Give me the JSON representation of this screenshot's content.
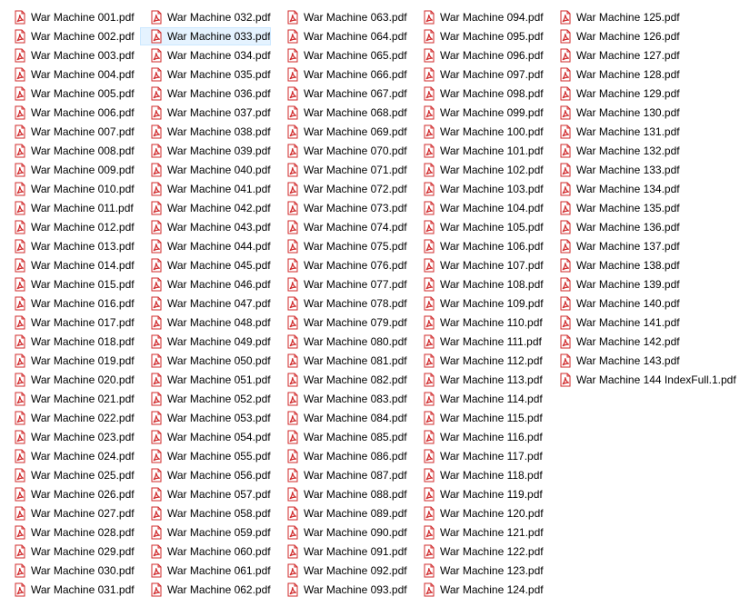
{
  "file_list": {
    "icon": "pdf-file-icon",
    "icon_color": "#d0282a",
    "hover_index": 32,
    "files": [
      "War Machine 001.pdf",
      "War Machine 002.pdf",
      "War Machine 003.pdf",
      "War Machine 004.pdf",
      "War Machine 005.pdf",
      "War Machine 006.pdf",
      "War Machine 007.pdf",
      "War Machine 008.pdf",
      "War Machine 009.pdf",
      "War Machine 010.pdf",
      "War Machine 011.pdf",
      "War Machine 012.pdf",
      "War Machine 013.pdf",
      "War Machine 014.pdf",
      "War Machine 015.pdf",
      "War Machine 016.pdf",
      "War Machine 017.pdf",
      "War Machine 018.pdf",
      "War Machine 019.pdf",
      "War Machine 020.pdf",
      "War Machine 021.pdf",
      "War Machine 022.pdf",
      "War Machine 023.pdf",
      "War Machine 024.pdf",
      "War Machine 025.pdf",
      "War Machine 026.pdf",
      "War Machine 027.pdf",
      "War Machine 028.pdf",
      "War Machine 029.pdf",
      "War Machine 030.pdf",
      "War Machine 031.pdf",
      "War Machine 032.pdf",
      "War Machine 033.pdf",
      "War Machine 034.pdf",
      "War Machine 035.pdf",
      "War Machine 036.pdf",
      "War Machine 037.pdf",
      "War Machine 038.pdf",
      "War Machine 039.pdf",
      "War Machine 040.pdf",
      "War Machine 041.pdf",
      "War Machine 042.pdf",
      "War Machine 043.pdf",
      "War Machine 044.pdf",
      "War Machine 045.pdf",
      "War Machine 046.pdf",
      "War Machine 047.pdf",
      "War Machine 048.pdf",
      "War Machine 049.pdf",
      "War Machine 050.pdf",
      "War Machine 051.pdf",
      "War Machine 052.pdf",
      "War Machine 053.pdf",
      "War Machine 054.pdf",
      "War Machine 055.pdf",
      "War Machine 056.pdf",
      "War Machine 057.pdf",
      "War Machine 058.pdf",
      "War Machine 059.pdf",
      "War Machine 060.pdf",
      "War Machine 061.pdf",
      "War Machine 062.pdf",
      "War Machine 063.pdf",
      "War Machine 064.pdf",
      "War Machine 065.pdf",
      "War Machine 066.pdf",
      "War Machine 067.pdf",
      "War Machine 068.pdf",
      "War Machine 069.pdf",
      "War Machine 070.pdf",
      "War Machine 071.pdf",
      "War Machine 072.pdf",
      "War Machine 073.pdf",
      "War Machine 074.pdf",
      "War Machine 075.pdf",
      "War Machine 076.pdf",
      "War Machine 077.pdf",
      "War Machine 078.pdf",
      "War Machine 079.pdf",
      "War Machine 080.pdf",
      "War Machine 081.pdf",
      "War Machine 082.pdf",
      "War Machine 083.pdf",
      "War Machine 084.pdf",
      "War Machine 085.pdf",
      "War Machine 086.pdf",
      "War Machine 087.pdf",
      "War Machine 088.pdf",
      "War Machine 089.pdf",
      "War Machine 090.pdf",
      "War Machine 091.pdf",
      "War Machine 092.pdf",
      "War Machine 093.pdf",
      "War Machine 094.pdf",
      "War Machine 095.pdf",
      "War Machine 096.pdf",
      "War Machine 097.pdf",
      "War Machine 098.pdf",
      "War Machine 099.pdf",
      "War Machine 100.pdf",
      "War Machine 101.pdf",
      "War Machine 102.pdf",
      "War Machine 103.pdf",
      "War Machine 104.pdf",
      "War Machine 105.pdf",
      "War Machine 106.pdf",
      "War Machine 107.pdf",
      "War Machine 108.pdf",
      "War Machine 109.pdf",
      "War Machine 110.pdf",
      "War Machine 111.pdf",
      "War Machine 112.pdf",
      "War Machine 113.pdf",
      "War Machine 114.pdf",
      "War Machine 115.pdf",
      "War Machine 116.pdf",
      "War Machine 117.pdf",
      "War Machine 118.pdf",
      "War Machine 119.pdf",
      "War Machine 120.pdf",
      "War Machine 121.pdf",
      "War Machine 122.pdf",
      "War Machine 123.pdf",
      "War Machine 124.pdf",
      "War Machine 125.pdf",
      "War Machine 126.pdf",
      "War Machine 127.pdf",
      "War Machine 128.pdf",
      "War Machine 129.pdf",
      "War Machine 130.pdf",
      "War Machine 131.pdf",
      "War Machine 132.pdf",
      "War Machine 133.pdf",
      "War Machine 134.pdf",
      "War Machine 135.pdf",
      "War Machine 136.pdf",
      "War Machine 137.pdf",
      "War Machine 138.pdf",
      "War Machine 139.pdf",
      "War Machine 140.pdf",
      "War Machine 141.pdf",
      "War Machine 142.pdf",
      "War Machine 143.pdf",
      "War Machine 144 IndexFull.1.pdf"
    ]
  }
}
